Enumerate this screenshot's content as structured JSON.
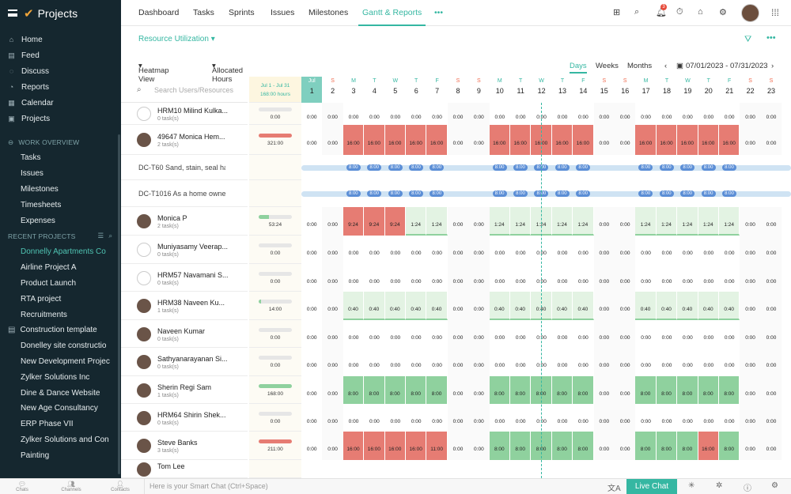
{
  "app": {
    "title": "Projects"
  },
  "sidebar": {
    "nav": [
      {
        "label": "Home",
        "icon": "home-icon"
      },
      {
        "label": "Feed",
        "icon": "feed-icon"
      },
      {
        "label": "Discuss",
        "icon": "discuss-icon"
      },
      {
        "label": "Reports",
        "icon": "reports-icon"
      },
      {
        "label": "Calendar",
        "icon": "calendar-icon"
      },
      {
        "label": "Projects",
        "icon": "projects-icon"
      }
    ],
    "work_overview_title": "WORK OVERVIEW",
    "work_items": [
      "Tasks",
      "Issues",
      "Milestones",
      "Timesheets",
      "Expenses"
    ],
    "recent_title": "RECENT PROJECTS",
    "recent": [
      "Donnelly Apartments Co",
      "Airline Project A",
      "Product Launch",
      "RTA project",
      "Recruitments",
      "Construction template",
      "Donelley site constructio",
      "New Development Projec",
      "Zylker Solutions Inc",
      "Dine & Dance Website",
      "New Age Consultancy",
      "ERP Phase VII",
      "Zylker Solutions and Con",
      "Painting"
    ]
  },
  "topbar": {
    "tabs": [
      "Dashboard",
      "Tasks",
      "Sprints",
      "Issues",
      "Milestones",
      "Gantt & Reports"
    ],
    "more": "•••",
    "notif_count": "3"
  },
  "view": {
    "title": "Resource Utilization",
    "heatmap": "Heatmap View",
    "allocated": "Allocated Hours",
    "days": "Days",
    "weeks": "Weeks",
    "months": "Months",
    "range": "07/01/2023 - 07/31/2023"
  },
  "search_placeholder": "Search Users/Resources",
  "summary_header": {
    "range": "Jul 1 - Jul 31",
    "hours": "168:00 hours"
  },
  "days": [
    {
      "l": "Jul",
      "n": "1"
    },
    {
      "l": "S",
      "n": "2"
    },
    {
      "l": "M",
      "n": "3"
    },
    {
      "l": "T",
      "n": "4"
    },
    {
      "l": "W",
      "n": "5"
    },
    {
      "l": "T",
      "n": "6"
    },
    {
      "l": "F",
      "n": "7"
    },
    {
      "l": "S",
      "n": "8"
    },
    {
      "l": "S",
      "n": "9"
    },
    {
      "l": "M",
      "n": "10"
    },
    {
      "l": "T",
      "n": "11"
    },
    {
      "l": "W",
      "n": "12"
    },
    {
      "l": "T",
      "n": "13"
    },
    {
      "l": "F",
      "n": "14"
    },
    {
      "l": "S",
      "n": "15"
    },
    {
      "l": "S",
      "n": "16"
    },
    {
      "l": "M",
      "n": "17"
    },
    {
      "l": "T",
      "n": "18"
    },
    {
      "l": "W",
      "n": "19"
    },
    {
      "l": "T",
      "n": "20"
    },
    {
      "l": "F",
      "n": "21"
    },
    {
      "l": "S",
      "n": "22"
    },
    {
      "l": "S",
      "n": "23"
    }
  ],
  "rows": [
    {
      "type": "user",
      "name": "HRM10 Milind Kulka...",
      "tasks": "0 task(s)",
      "total": "0:00",
      "fill": 0,
      "cells": [
        "0:00",
        "0:00",
        "0:00",
        "0:00",
        "0:00",
        "0:00",
        "0:00",
        "0:00",
        "0:00",
        "0:00",
        "0:00",
        "0:00",
        "0:00",
        "0:00",
        "0:00",
        "0:00",
        "0:00",
        "0:00",
        "0:00",
        "0:00",
        "0:00",
        "0:00",
        "0:00"
      ],
      "color": "none"
    },
    {
      "type": "user",
      "name": "49647 Monica Hem...",
      "tasks": "2 task(s)",
      "total": "321:00",
      "fill": 1,
      "cells": [
        "0:00",
        "0:00",
        "16:00",
        "16:00",
        "16:00",
        "16:00",
        "16:00",
        "0:00",
        "0:00",
        "16:00",
        "16:00",
        "16:00",
        "16:00",
        "16:00",
        "0:00",
        "0:00",
        "16:00",
        "16:00",
        "16:00",
        "16:00",
        "16:00",
        "0:00",
        "0:00"
      ],
      "color": "red"
    },
    {
      "type": "task",
      "name": "DC-T60 Sand, stain, seal ha...",
      "pill": "8:00"
    },
    {
      "type": "task",
      "name": "DC-T1016 As a home owner,...",
      "pill": "8:00"
    },
    {
      "type": "user",
      "name": "Monica P",
      "tasks": "2 task(s)",
      "total": "53:24",
      "fill": 0.32,
      "cells": [
        "0:00",
        "0:00",
        "9:24",
        "9:24",
        "9:24",
        "1:24",
        "1:24",
        "0:00",
        "0:00",
        "1:24",
        "1:24",
        "1:24",
        "1:24",
        "1:24",
        "0:00",
        "0:00",
        "1:24",
        "1:24",
        "1:24",
        "1:24",
        "1:24",
        "0:00",
        "0:00"
      ],
      "color": "mix"
    },
    {
      "type": "user",
      "name": "Muniyasamy Veerap...",
      "tasks": "0 task(s)",
      "total": "0:00",
      "fill": 0,
      "cells": [
        "0:00",
        "0:00",
        "0:00",
        "0:00",
        "0:00",
        "0:00",
        "0:00",
        "0:00",
        "0:00",
        "0:00",
        "0:00",
        "0:00",
        "0:00",
        "0:00",
        "0:00",
        "0:00",
        "0:00",
        "0:00",
        "0:00",
        "0:00",
        "0:00",
        "0:00",
        "0:00"
      ],
      "color": "none"
    },
    {
      "type": "user",
      "name": "HRM57 Navamani S...",
      "tasks": "0 task(s)",
      "total": "0:00",
      "fill": 0,
      "cells": [
        "0:00",
        "0:00",
        "0:00",
        "0:00",
        "0:00",
        "0:00",
        "0:00",
        "0:00",
        "0:00",
        "0:00",
        "0:00",
        "0:00",
        "0:00",
        "0:00",
        "0:00",
        "0:00",
        "0:00",
        "0:00",
        "0:00",
        "0:00",
        "0:00",
        "0:00",
        "0:00"
      ],
      "color": "none"
    },
    {
      "type": "user",
      "name": "HRM38 Naveen Ku...",
      "tasks": "1 task(s)",
      "total": "14:00",
      "fill": 0.08,
      "cells": [
        "0:00",
        "0:00",
        "0:40",
        "0:40",
        "0:40",
        "0:40",
        "0:40",
        "0:00",
        "0:00",
        "0:40",
        "0:40",
        "0:40",
        "0:40",
        "0:40",
        "0:00",
        "0:00",
        "0:40",
        "0:40",
        "0:40",
        "0:40",
        "0:40",
        "0:00",
        "0:00"
      ],
      "color": "light"
    },
    {
      "type": "user",
      "name": "Naveen Kumar",
      "tasks": "0 task(s)",
      "total": "0:00",
      "fill": 0,
      "cells": [
        "0:00",
        "0:00",
        "0:00",
        "0:00",
        "0:00",
        "0:00",
        "0:00",
        "0:00",
        "0:00",
        "0:00",
        "0:00",
        "0:00",
        "0:00",
        "0:00",
        "0:00",
        "0:00",
        "0:00",
        "0:00",
        "0:00",
        "0:00",
        "0:00",
        "0:00",
        "0:00"
      ],
      "color": "none"
    },
    {
      "type": "user",
      "name": "Sathyanarayanan Si...",
      "tasks": "0 task(s)",
      "total": "0:00",
      "fill": 0,
      "cells": [
        "0:00",
        "0:00",
        "0:00",
        "0:00",
        "0:00",
        "0:00",
        "0:00",
        "0:00",
        "0:00",
        "0:00",
        "0:00",
        "0:00",
        "0:00",
        "0:00",
        "0:00",
        "0:00",
        "0:00",
        "0:00",
        "0:00",
        "0:00",
        "0:00",
        "0:00",
        "0:00"
      ],
      "color": "none"
    },
    {
      "type": "user",
      "name": "Sherin Regi Sam",
      "tasks": "1 task(s)",
      "total": "168:00",
      "fill": 1,
      "cells": [
        "0:00",
        "0:00",
        "8:00",
        "8:00",
        "8:00",
        "8:00",
        "8:00",
        "0:00",
        "0:00",
        "8:00",
        "8:00",
        "8:00",
        "8:00",
        "8:00",
        "0:00",
        "0:00",
        "8:00",
        "8:00",
        "8:00",
        "8:00",
        "8:00",
        "0:00",
        "0:00"
      ],
      "color": "green"
    },
    {
      "type": "user",
      "name": "HRM64 Shirin Shek...",
      "tasks": "0 task(s)",
      "total": "0:00",
      "fill": 0,
      "cells": [
        "0:00",
        "0:00",
        "0:00",
        "0:00",
        "0:00",
        "0:00",
        "0:00",
        "0:00",
        "0:00",
        "0:00",
        "0:00",
        "0:00",
        "0:00",
        "0:00",
        "0:00",
        "0:00",
        "0:00",
        "0:00",
        "0:00",
        "0:00",
        "0:00",
        "0:00",
        "0:00"
      ],
      "color": "none"
    },
    {
      "type": "user",
      "name": "Steve Banks",
      "tasks": "3 task(s)",
      "total": "211:00",
      "fill": 1,
      "cells": [
        "0:00",
        "0:00",
        "16:00",
        "16:00",
        "16:00",
        "16:00",
        "11:00",
        "0:00",
        "0:00",
        "8:00",
        "8:00",
        "8:00",
        "8:00",
        "8:00",
        "0:00",
        "0:00",
        "8:00",
        "8:00",
        "8:00",
        "16:00",
        "8:00",
        "0:00",
        "0:00"
      ],
      "color": "steve"
    },
    {
      "type": "user",
      "name": "Tom Lee",
      "tasks": "",
      "total": "",
      "fill": 0,
      "cells": [],
      "color": "none"
    }
  ],
  "bottom": {
    "chats": "Chats",
    "channels": "Channels",
    "contacts": "Contacts",
    "smart_placeholder": "Here is your Smart Chat (Ctrl+Space)",
    "live_chat": "Live Chat"
  },
  "colors": {
    "accent": "#35b7a2",
    "over": "#e67c73",
    "ok": "#8fd19e",
    "light": "#e3f3e3",
    "pill": "#5b8ed6"
  }
}
